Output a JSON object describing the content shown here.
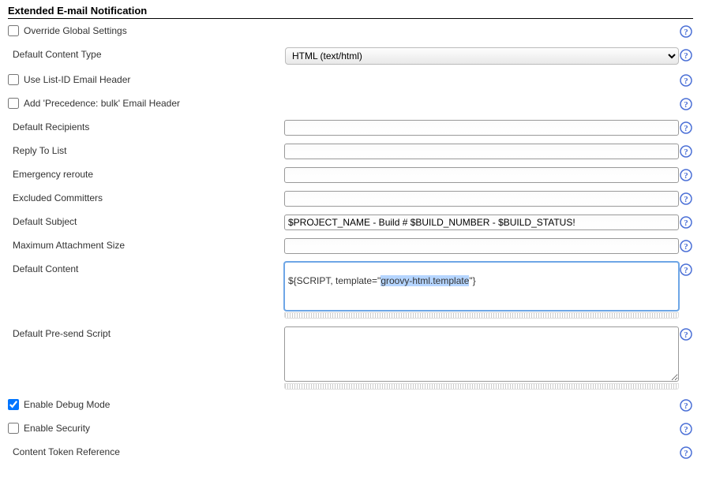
{
  "section_title": "Extended E-mail Notification",
  "rows": {
    "override_global": {
      "label": "Override Global Settings",
      "checked": false
    },
    "default_content_type": {
      "label": "Default Content Type",
      "selected": "HTML (text/html)"
    },
    "use_listid": {
      "label": "Use List-ID Email Header",
      "checked": false
    },
    "add_precedence": {
      "label": "Add 'Precedence: bulk' Email Header",
      "checked": false
    },
    "default_recipients": {
      "label": "Default Recipients",
      "value": ""
    },
    "reply_to": {
      "label": "Reply To List",
      "value": ""
    },
    "emergency_reroute": {
      "label": "Emergency reroute",
      "value": ""
    },
    "excluded_committers": {
      "label": "Excluded Committers",
      "value": ""
    },
    "default_subject": {
      "label": "Default Subject",
      "value": "$PROJECT_NAME - Build # $BUILD_NUMBER - $BUILD_STATUS!"
    },
    "max_attachment": {
      "label": "Maximum Attachment Size",
      "value": ""
    },
    "default_content": {
      "label": "Default Content",
      "prefix": "${SCRIPT, template=\"",
      "highlighted": "groovy-html.template",
      "suffix": "\"}"
    },
    "default_presend": {
      "label": "Default Pre-send Script",
      "value": ""
    },
    "enable_debug": {
      "label": "Enable Debug Mode",
      "checked": true
    },
    "enable_security": {
      "label": "Enable Security",
      "checked": false
    },
    "content_token_ref": {
      "label": "Content Token Reference"
    }
  }
}
